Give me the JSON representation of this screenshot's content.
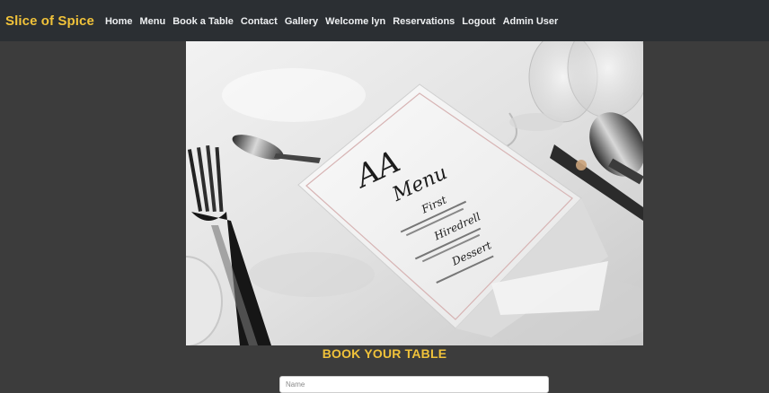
{
  "nav": {
    "brand": "Slice of Spice",
    "links": [
      {
        "label": "Home"
      },
      {
        "label": "Menu"
      },
      {
        "label": "Book a Table"
      },
      {
        "label": "Contact"
      },
      {
        "label": "Gallery"
      },
      {
        "label": "Welcome lyn"
      },
      {
        "label": "Reservations"
      },
      {
        "label": "Logout"
      },
      {
        "label": "Admin User"
      }
    ]
  },
  "hero": {
    "menu_card_monogram": "AA",
    "menu_card_title": "Menu",
    "menu_card_sections": [
      "First",
      "Hiredrell",
      "Dessert"
    ]
  },
  "booking": {
    "title": "BOOK YOUR TABLE",
    "name_placeholder": "Name"
  },
  "colors": {
    "navbar_bg": "#2b2f33",
    "page_bg": "#3c3c3c",
    "accent": "#f0c23a"
  }
}
